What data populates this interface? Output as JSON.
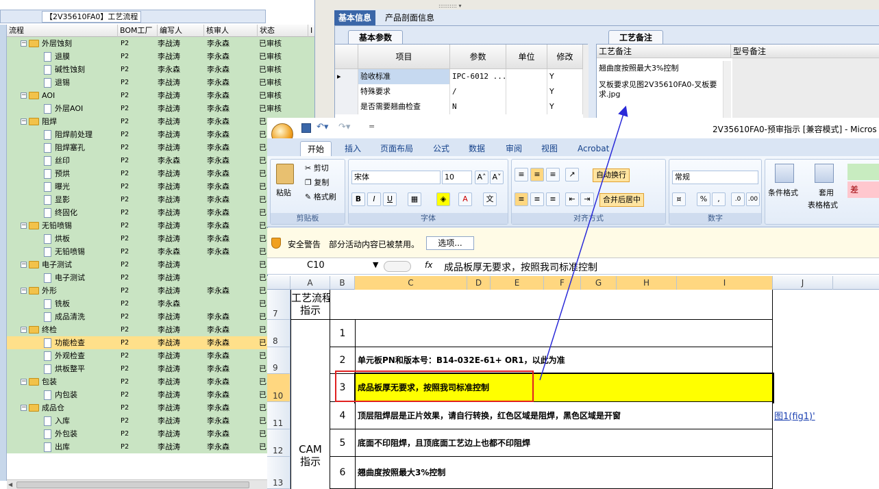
{
  "left": {
    "title": "【2V35610FA0】工艺流程",
    "columns": [
      "流程",
      "BOM工厂",
      "编写人",
      "核审人",
      "状态",
      "I"
    ],
    "rows": [
      {
        "level": 1,
        "type": "folder",
        "name": "外层蚀刻",
        "bom": "P2",
        "writer": "李战涛",
        "reviewer": "李永森",
        "status": "已审核"
      },
      {
        "level": 2,
        "type": "doc",
        "name": "退膜",
        "bom": "P2",
        "writer": "李战涛",
        "reviewer": "李永森",
        "status": "已审核"
      },
      {
        "level": 2,
        "type": "doc",
        "name": "碱性蚀刻",
        "bom": "P2",
        "writer": "李永森",
        "reviewer": "李永森",
        "status": "已审核"
      },
      {
        "level": 2,
        "type": "doc",
        "name": "退锡",
        "bom": "P2",
        "writer": "李战涛",
        "reviewer": "李永森",
        "status": "已审核"
      },
      {
        "level": 1,
        "type": "folder",
        "name": "AOI",
        "bom": "P2",
        "writer": "李战涛",
        "reviewer": "李永森",
        "status": "已审核"
      },
      {
        "level": 2,
        "type": "doc",
        "name": "外层AOI",
        "bom": "P2",
        "writer": "李战涛",
        "reviewer": "李永森",
        "status": "已审核"
      },
      {
        "level": 1,
        "type": "folder",
        "name": "阻焊",
        "bom": "P2",
        "writer": "李战涛",
        "reviewer": "李永森",
        "status": "已"
      },
      {
        "level": 2,
        "type": "doc",
        "name": "阻焊前处理",
        "bom": "P2",
        "writer": "李战涛",
        "reviewer": "李永森",
        "status": "已"
      },
      {
        "level": 2,
        "type": "doc",
        "name": "阻焊塞孔",
        "bom": "P2",
        "writer": "李战涛",
        "reviewer": "李永森",
        "status": "已"
      },
      {
        "level": 2,
        "type": "doc",
        "name": "丝印",
        "bom": "P2",
        "writer": "李永森",
        "reviewer": "李永森",
        "status": "已"
      },
      {
        "level": 2,
        "type": "doc",
        "name": "预烘",
        "bom": "P2",
        "writer": "李战涛",
        "reviewer": "李永森",
        "status": "已"
      },
      {
        "level": 2,
        "type": "doc",
        "name": "曝光",
        "bom": "P2",
        "writer": "李战涛",
        "reviewer": "李永森",
        "status": "已"
      },
      {
        "level": 2,
        "type": "doc",
        "name": "显影",
        "bom": "P2",
        "writer": "李战涛",
        "reviewer": "李永森",
        "status": "已"
      },
      {
        "level": 2,
        "type": "doc",
        "name": "终固化",
        "bom": "P2",
        "writer": "李战涛",
        "reviewer": "李永森",
        "status": "已"
      },
      {
        "level": 1,
        "type": "folder",
        "name": "无铅喷锡",
        "bom": "P2",
        "writer": "李战涛",
        "reviewer": "李永森",
        "status": "已"
      },
      {
        "level": 2,
        "type": "doc",
        "name": "烘板",
        "bom": "P2",
        "writer": "李战涛",
        "reviewer": "李永森",
        "status": "已"
      },
      {
        "level": 2,
        "type": "doc",
        "name": "无铅喷锡",
        "bom": "P2",
        "writer": "李永森",
        "reviewer": "李永森",
        "status": "已"
      },
      {
        "level": 1,
        "type": "folder",
        "name": "电子测试",
        "bom": "P2",
        "writer": "李战涛",
        "reviewer": "",
        "status": "已"
      },
      {
        "level": 2,
        "type": "doc",
        "name": "电子测试",
        "bom": "P2",
        "writer": "李战涛",
        "reviewer": "",
        "status": "已"
      },
      {
        "level": 1,
        "type": "folder",
        "name": "外形",
        "bom": "P2",
        "writer": "李战涛",
        "reviewer": "李永森",
        "status": "已"
      },
      {
        "level": 2,
        "type": "doc",
        "name": "铣板",
        "bom": "P2",
        "writer": "李永森",
        "reviewer": "",
        "status": "已"
      },
      {
        "level": 2,
        "type": "doc",
        "name": "成品清洗",
        "bom": "P2",
        "writer": "李战涛",
        "reviewer": "李永森",
        "status": "已"
      },
      {
        "level": 1,
        "type": "folder",
        "name": "终检",
        "bom": "P2",
        "writer": "李战涛",
        "reviewer": "李永森",
        "status": "已"
      },
      {
        "level": 2,
        "type": "doc",
        "name": "功能检查",
        "bom": "P2",
        "writer": "李战涛",
        "reviewer": "李永森",
        "status": "已",
        "selected": true
      },
      {
        "level": 2,
        "type": "doc",
        "name": "外观检查",
        "bom": "P2",
        "writer": "李战涛",
        "reviewer": "李永森",
        "status": "已"
      },
      {
        "level": 2,
        "type": "doc",
        "name": "烘板整平",
        "bom": "P2",
        "writer": "李战涛",
        "reviewer": "李永森",
        "status": "已"
      },
      {
        "level": 1,
        "type": "folder",
        "name": "包装",
        "bom": "P2",
        "writer": "李战涛",
        "reviewer": "李永森",
        "status": "已"
      },
      {
        "level": 2,
        "type": "doc",
        "name": "内包装",
        "bom": "P2",
        "writer": "李战涛",
        "reviewer": "李永森",
        "status": "已"
      },
      {
        "level": 1,
        "type": "folder",
        "name": "成品仓",
        "bom": "P2",
        "writer": "李战涛",
        "reviewer": "李永森",
        "status": "已"
      },
      {
        "level": 2,
        "type": "doc",
        "name": "入库",
        "bom": "P2",
        "writer": "李战涛",
        "reviewer": "李永森",
        "status": "已"
      },
      {
        "level": 2,
        "type": "doc",
        "name": "外包装",
        "bom": "P2",
        "writer": "李战涛",
        "reviewer": "李永森",
        "status": "已"
      },
      {
        "level": 2,
        "type": "doc",
        "name": "出库",
        "bom": "P2",
        "writer": "李战涛",
        "reviewer": "李永森",
        "status": "已"
      }
    ]
  },
  "right_top": {
    "tabs": [
      "基本信息",
      "产品剖面信息"
    ],
    "basic_params_title": "基本参数",
    "process_note_title": "工艺备注",
    "grid_columns": [
      "项目",
      "参数",
      "单位",
      "修改"
    ],
    "grid_rows": [
      {
        "item": "验收标准",
        "param": "IPC-6012 ...",
        "unit": "",
        "modify": "Y"
      },
      {
        "item": "特殊要求",
        "param": "/",
        "unit": "",
        "modify": "Y"
      },
      {
        "item": "是否需要翘曲检查",
        "param": "N",
        "unit": "",
        "modify": "Y"
      }
    ],
    "note_columns": [
      "工艺备注",
      "型号备注"
    ],
    "note_lines": [
      "翘曲度按照最大3%控制",
      "叉板要求见图2V35610FA0-叉板要求.jpg"
    ]
  },
  "excel": {
    "window_title": "2V35610FA0-预审指示 [兼容模式] - Micros",
    "ribbon_tabs": [
      "开始",
      "插入",
      "页面布局",
      "公式",
      "数据",
      "审阅",
      "视图",
      "Acrobat"
    ],
    "clipboard": {
      "paste": "粘贴",
      "cut": "剪切",
      "copy": "复制",
      "format_painter": "格式刷",
      "label": "剪贴板"
    },
    "font": {
      "name": "宋体",
      "size": "10",
      "label": "字体"
    },
    "alignment": {
      "wrap": "自动换行",
      "merge": "合并后居中",
      "label": "对齐方式"
    },
    "number": {
      "format": "常规",
      "label": "数字"
    },
    "styles": {
      "cond": "条件格式",
      "table": "套用",
      "table2": "表格格式",
      "bad": "差"
    },
    "security": {
      "label": "安全警告",
      "message": "部分活动内容已被禁用。",
      "options": "选项..."
    },
    "formula": {
      "cellref": "C10",
      "fx": "fx",
      "content": "成品板厚无要求，按照我司标准控制"
    },
    "columns": [
      "A",
      "B",
      "C",
      "D",
      "E",
      "F",
      "G",
      "H",
      "I",
      "J"
    ],
    "row_numbers": [
      "7",
      "8",
      "9",
      "10",
      "11",
      "12",
      "13"
    ],
    "section_a7": "工艺流程\n指示",
    "section_cam": "CAM\n指示",
    "items": [
      {
        "num": "1",
        "text": ""
      },
      {
        "num": "2",
        "text": "单元板PN和版本号：B14-032E-61+ OR1，以此为准"
      },
      {
        "num": "3",
        "text": "成品板厚无要求，按照我司标准控制"
      },
      {
        "num": "4",
        "text": "顶层阻焊层是正片效果，请自行转换，红色区域是阻焊，黑色区域是开窗"
      },
      {
        "num": "5",
        "text": "底面不印阻焊，且顶底面工艺边上也都不印阻焊"
      },
      {
        "num": "6",
        "text": "翘曲度按照最大3%控制"
      }
    ],
    "link_j11": "图1(fig1)'"
  }
}
